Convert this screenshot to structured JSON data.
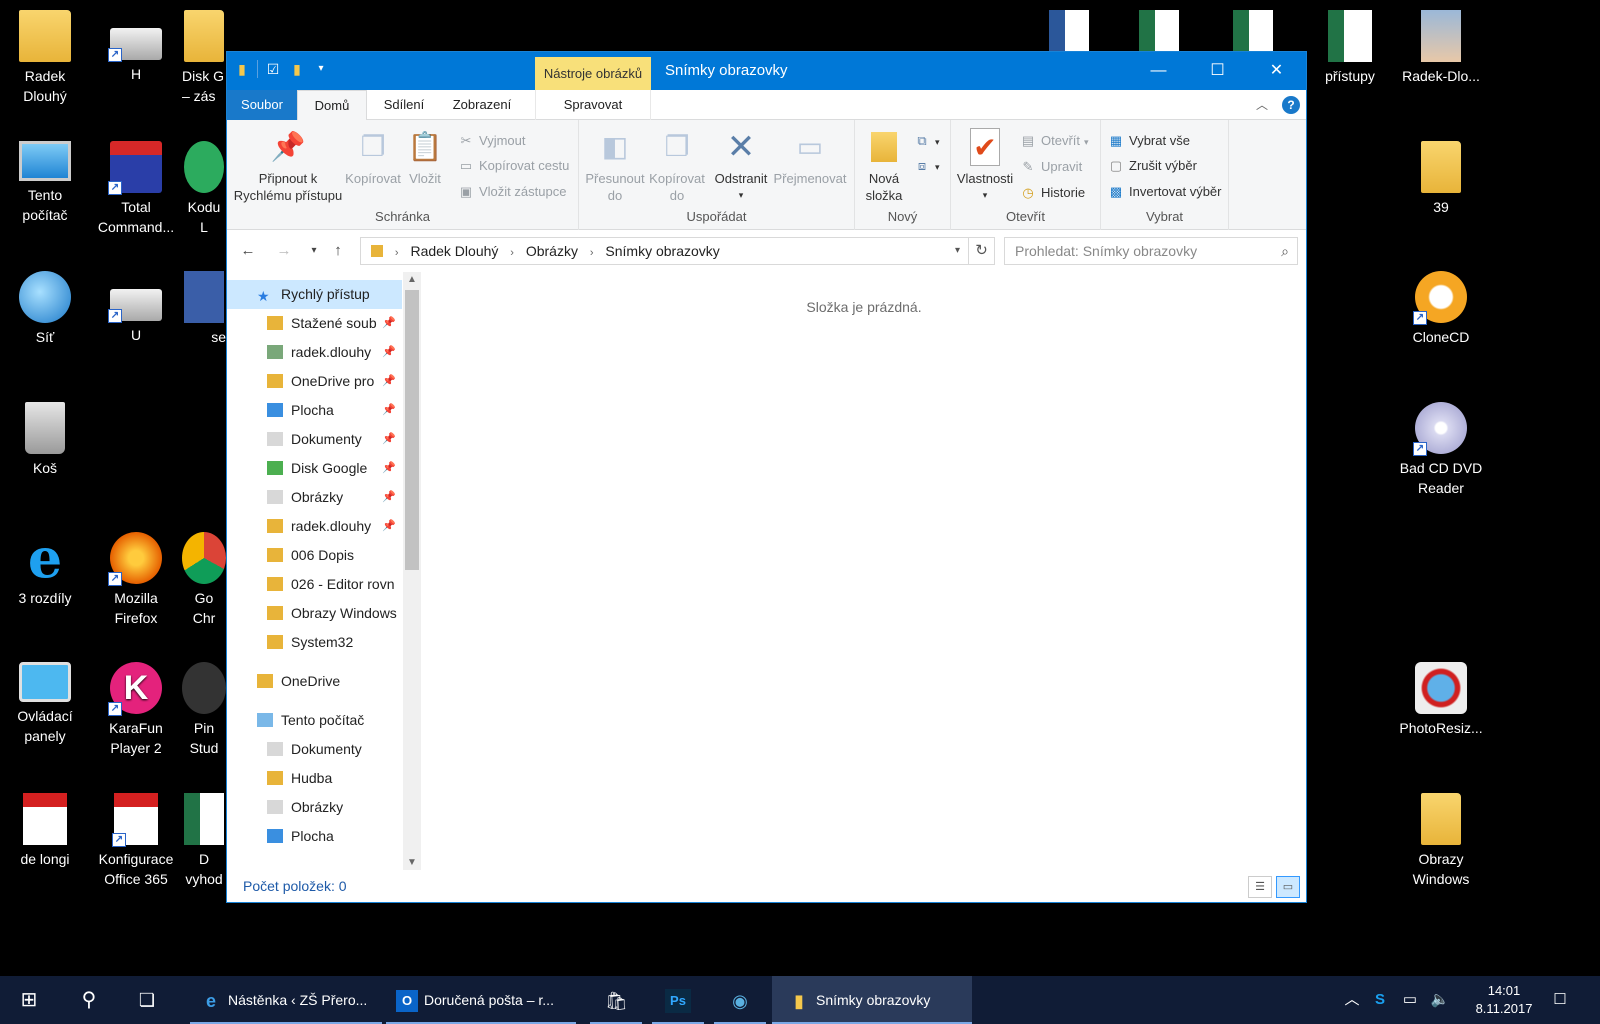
{
  "desktop": {
    "icons": [
      {
        "label": "Radek\nDlouhý",
        "icon": "user-folder-icon"
      },
      {
        "label": "H",
        "icon": "drive-icon"
      },
      {
        "label": "Disk G\n– zás",
        "icon": "folder-icon"
      },
      {
        "label": "Tento\npočítač",
        "icon": "computer-icon"
      },
      {
        "label": "Total\nCommand...",
        "icon": "floppy-icon"
      },
      {
        "label": "Kodu\nL",
        "icon": "app-icon"
      },
      {
        "label": "Síť",
        "icon": "network-icon"
      },
      {
        "label": "U",
        "icon": "drive-icon"
      },
      {
        "label": "se",
        "icon": "app-icon"
      },
      {
        "label": "Koš",
        "icon": "recycle-bin-icon"
      },
      {
        "label": "3 rozdíly",
        "icon": "ie-icon"
      },
      {
        "label": "Mozilla\nFirefox",
        "icon": "firefox-icon"
      },
      {
        "label": "Go\nChr",
        "icon": "chrome-icon"
      },
      {
        "label": "Ovládací\npanely",
        "icon": "control-panel-icon"
      },
      {
        "label": "KaraFun\nPlayer 2",
        "icon": "karafun-icon"
      },
      {
        "label": "Pin\nStud",
        "icon": "app-icon"
      },
      {
        "label": "de longi",
        "icon": "pdf-icon"
      },
      {
        "label": "Konfigurace\nOffice 365",
        "icon": "pdf-icon"
      },
      {
        "label": "D\nvyhod",
        "icon": "excel-icon"
      },
      {
        "label": "přístupy",
        "icon": "excel-icon"
      },
      {
        "label": "Radek-Dlo...",
        "icon": "photo-icon"
      },
      {
        "label": "39",
        "icon": "folder-icon"
      },
      {
        "label": "CloneCD",
        "icon": "clonecd-icon"
      },
      {
        "label": "Bad CD DVD\nReader",
        "icon": "dvd-icon"
      },
      {
        "label": "PhotoResiz...",
        "icon": "photoresizer-icon"
      },
      {
        "label": "Obrazy\nWindows",
        "icon": "folder-icon"
      }
    ]
  },
  "window": {
    "context_tab": "Nástroje obrázků",
    "title": "Snímky obrazovky",
    "controls": {
      "minimize": "—",
      "maximize": "☐",
      "close": "✕"
    },
    "tabs": {
      "file": "Soubor",
      "home": "Domů",
      "share": "Sdílení",
      "view": "Zobrazení",
      "manage": "Spravovat"
    },
    "ribbon": {
      "clipboard": {
        "name": "Schránka",
        "pin_l1": "Připnout k",
        "pin_l2": "Rychlému přístupu",
        "copy": "Kopírovat",
        "paste": "Vložit",
        "cut": "Vyjmout",
        "copy_path": "Kopírovat cestu",
        "paste_shortcut": "Vložit zástupce"
      },
      "organize": {
        "name": "Uspořádat",
        "move_l1": "Přesunout",
        "move_l2": "do",
        "copy_l1": "Kopírovat",
        "copy_l2": "do",
        "delete": "Odstranit",
        "rename": "Přejmenovat"
      },
      "new": {
        "name": "Nový",
        "new_l1": "Nová",
        "new_l2": "složka"
      },
      "open": {
        "name": "Otevřít",
        "properties": "Vlastnosti",
        "open": "Otevřít",
        "edit": "Upravit",
        "history": "Historie"
      },
      "select": {
        "name": "Vybrat",
        "all": "Vybrat vše",
        "none": "Zrušit výběr",
        "invert": "Invertovat výběr"
      }
    },
    "address": {
      "parts": [
        "Radek Dlouhý",
        "Obrázky",
        "Snímky obrazovky"
      ],
      "search_placeholder": "Prohledat: Snímky obrazovky"
    },
    "nav": [
      {
        "label": "Rychlý přístup",
        "indent": 1,
        "selected": true,
        "pinned": false,
        "icon": "star-icon"
      },
      {
        "label": "Stažené soub",
        "indent": 2,
        "pinned": true,
        "icon": "download-folder-icon"
      },
      {
        "label": "radek.dlouhy",
        "indent": 2,
        "pinned": true,
        "icon": "network-drive-icon"
      },
      {
        "label": "OneDrive pro",
        "indent": 2,
        "pinned": true,
        "icon": "folder-icon"
      },
      {
        "label": "Plocha",
        "indent": 2,
        "pinned": true,
        "icon": "desktop-folder-icon"
      },
      {
        "label": "Dokumenty",
        "indent": 2,
        "pinned": true,
        "icon": "documents-icon"
      },
      {
        "label": "Disk Google",
        "indent": 2,
        "pinned": true,
        "icon": "google-drive-icon"
      },
      {
        "label": "Obrázky",
        "indent": 2,
        "pinned": true,
        "icon": "pictures-icon"
      },
      {
        "label": "radek.dlouhy",
        "indent": 2,
        "pinned": true,
        "icon": "folder-icon"
      },
      {
        "label": "006 Dopis",
        "indent": 2,
        "pinned": false,
        "icon": "folder-icon"
      },
      {
        "label": "026 - Editor rovn",
        "indent": 2,
        "pinned": false,
        "icon": "folder-icon"
      },
      {
        "label": "Obrazy Windows",
        "indent": 2,
        "pinned": false,
        "icon": "folder-icon"
      },
      {
        "label": "System32",
        "indent": 2,
        "pinned": false,
        "icon": "folder-icon"
      },
      {
        "label": "OneDrive",
        "indent": 1,
        "pinned": false,
        "icon": "folder-icon"
      },
      {
        "label": "Tento počítač",
        "indent": 1,
        "pinned": false,
        "icon": "computer-icon"
      },
      {
        "label": "Dokumenty",
        "indent": 2,
        "pinned": false,
        "icon": "documents-icon"
      },
      {
        "label": "Hudba",
        "indent": 2,
        "pinned": false,
        "icon": "music-icon"
      },
      {
        "label": "Obrázky",
        "indent": 2,
        "pinned": false,
        "icon": "pictures-icon"
      },
      {
        "label": "Plocha",
        "indent": 2,
        "pinned": false,
        "icon": "desktop-folder-icon"
      }
    ],
    "empty_message": "Složka je prázdná.",
    "status": "Počet položek: 0"
  },
  "taskbar": {
    "apps": [
      {
        "label": "Nástěnka ‹ ZŠ Přero...",
        "icon": "edge-icon"
      },
      {
        "label": "Doručená pošta – r...",
        "icon": "outlook-icon"
      },
      {
        "label": "",
        "icon": "store-icon"
      },
      {
        "label": "",
        "icon": "photoshop-icon"
      },
      {
        "label": "",
        "icon": "eye-app-icon"
      },
      {
        "label": "Snímky obrazovky",
        "icon": "explorer-icon"
      }
    ],
    "time": "14:01",
    "date": "8.11.2017"
  },
  "colors": {
    "accent": "#0078d7",
    "taskbar": "#101c36",
    "context_tab": "#f8e07a",
    "selected": "#cce8ff"
  }
}
